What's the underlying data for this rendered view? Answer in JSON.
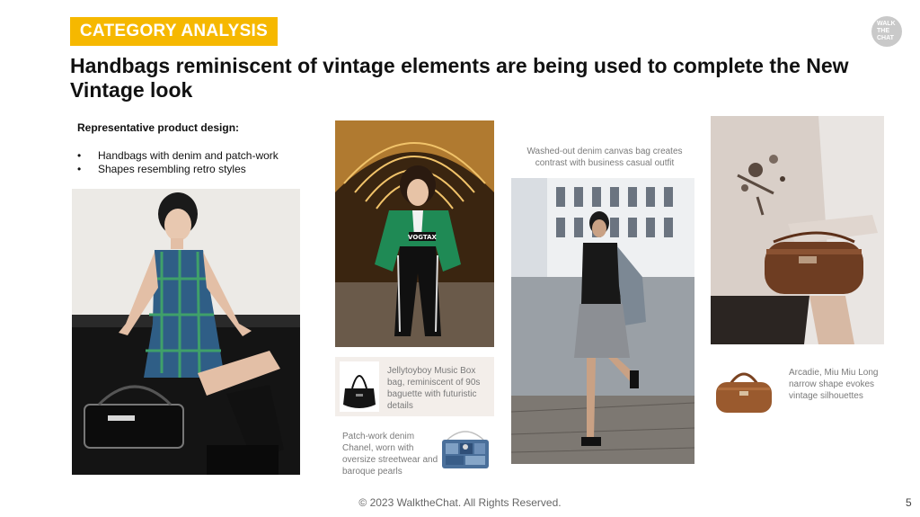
{
  "header": {
    "tag": "CATEGORY ANALYSIS",
    "logo_lines": [
      "WALK",
      "THE",
      "CHAT"
    ],
    "headline": "Handbags reminiscent of vintage elements are being used to complete the New Vintage look"
  },
  "intro": {
    "subhead": "Representative product design:",
    "bullets": [
      "Handbags with denim and patch-work",
      "Shapes resembling retro styles"
    ]
  },
  "captions": {
    "washed_denim": "Washed-out denim canvas bag creates contrast with business casual outfit",
    "jellytoyboy": "Jellytoyboy Music Box bag, reminiscent of 90s baguette with futuristic details",
    "chanel": "Patch-work denim Chanel, worn with oversize streetwear and baroque pearls",
    "miumiu": "Arcadie, Miu Miu Long narrow shape evokes vintage silhouettes"
  },
  "photo_text": {
    "sweater": "VOGTAX"
  },
  "footer": {
    "copyright": "© 2023 WalktheChat. All Rights Reserved.",
    "page_number": "5"
  }
}
